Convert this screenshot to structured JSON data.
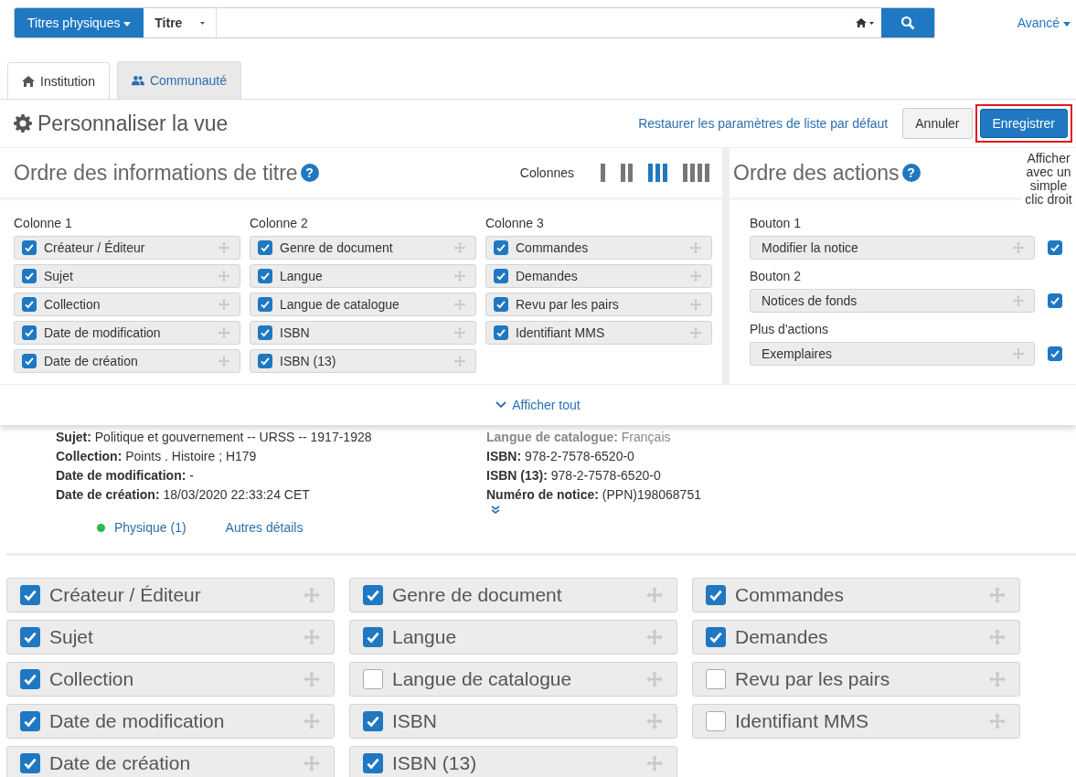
{
  "search": {
    "scope": "Titres physiques",
    "field": "Titre",
    "advanced": "Avancé"
  },
  "tabs": [
    {
      "label": "Institution",
      "selected": true
    },
    {
      "label": "Communauté",
      "selected": false
    }
  ],
  "panel": {
    "title": "Personnaliser la vue",
    "restore": "Restaurer les paramètres de liste par défaut",
    "cancel": "Annuler",
    "save": "Enregistrer",
    "save_highlighted": true
  },
  "title_info": {
    "heading": "Ordre des informations de titre",
    "help": "?",
    "columns_label": "Colonnes",
    "column_options": [
      {
        "selected": false
      },
      {
        "selected": false
      },
      {
        "selected": true
      },
      {
        "selected": false
      }
    ],
    "columns": [
      {
        "label": "Colonne 1",
        "items": [
          {
            "label": "Créateur / Éditeur",
            "checked": true
          },
          {
            "label": "Sujet",
            "checked": true
          },
          {
            "label": "Collection",
            "checked": true
          },
          {
            "label": "Date de modification",
            "checked": true
          },
          {
            "label": "Date de création",
            "checked": true
          }
        ]
      },
      {
        "label": "Colonne 2",
        "items": [
          {
            "label": "Genre de document",
            "checked": true
          },
          {
            "label": "Langue",
            "checked": true
          },
          {
            "label": "Langue de catalogue",
            "checked": true
          },
          {
            "label": "ISBN",
            "checked": true
          },
          {
            "label": "ISBN (13)",
            "checked": true
          }
        ]
      },
      {
        "label": "Colonne 3",
        "items": [
          {
            "label": "Commandes",
            "checked": true
          },
          {
            "label": "Demandes",
            "checked": true
          },
          {
            "label": "Revu par les pairs",
            "checked": true
          },
          {
            "label": "Identifiant MMS",
            "checked": true
          }
        ]
      }
    ]
  },
  "actions": {
    "heading": "Ordre des actions",
    "help": "?",
    "right_click_label": "Afficher avec un simple clic droit",
    "groups": [
      {
        "label": "Bouton 1",
        "items": [
          {
            "label": "Modifier la notice",
            "checked": true
          }
        ]
      },
      {
        "label": "Bouton 2",
        "items": [
          {
            "label": "Notices de fonds",
            "checked": true
          }
        ]
      },
      {
        "label": "Plus d'actions",
        "items": [
          {
            "label": "Exemplaires",
            "checked": true
          }
        ]
      }
    ]
  },
  "show_all": "Afficher tout",
  "record": {
    "left": [
      {
        "label": "Sujet:",
        "value": "Politique et gouvernement -- URSS -- 1917-1928"
      },
      {
        "label": "Collection:",
        "value": "Points . Histoire ; H179"
      },
      {
        "label": "Date de modification:",
        "value": "-"
      },
      {
        "label": "Date de création:",
        "value": "18/03/2020 22:33:24 CET"
      }
    ],
    "right": [
      {
        "label": "Langue de catalogue:",
        "value": "Français"
      },
      {
        "label": "ISBN:",
        "value": "978-2-7578-6520-0"
      },
      {
        "label": "ISBN (13):",
        "value": "978-2-7578-6520-0"
      },
      {
        "label": "Numéro de notice:",
        "value": "(PPN)198068751"
      }
    ],
    "availability": {
      "label": "Physique (1)",
      "color": "#2db84b"
    },
    "details": "Autres détails"
  },
  "preview_columns": [
    [
      {
        "label": "Créateur / Éditeur",
        "checked": true
      },
      {
        "label": "Sujet",
        "checked": true
      },
      {
        "label": "Collection",
        "checked": true
      },
      {
        "label": "Date de modification",
        "checked": true
      },
      {
        "label": "Date de création",
        "checked": true
      }
    ],
    [
      {
        "label": "Genre de document",
        "checked": true
      },
      {
        "label": "Langue",
        "checked": true
      },
      {
        "label": "Langue de catalogue",
        "checked": false
      },
      {
        "label": "ISBN",
        "checked": true
      },
      {
        "label": "ISBN (13)",
        "checked": true
      }
    ],
    [
      {
        "label": "Commandes",
        "checked": true
      },
      {
        "label": "Demandes",
        "checked": true
      },
      {
        "label": "Revu par les pairs",
        "checked": false
      },
      {
        "label": "Identifiant MMS",
        "checked": false
      }
    ]
  ]
}
